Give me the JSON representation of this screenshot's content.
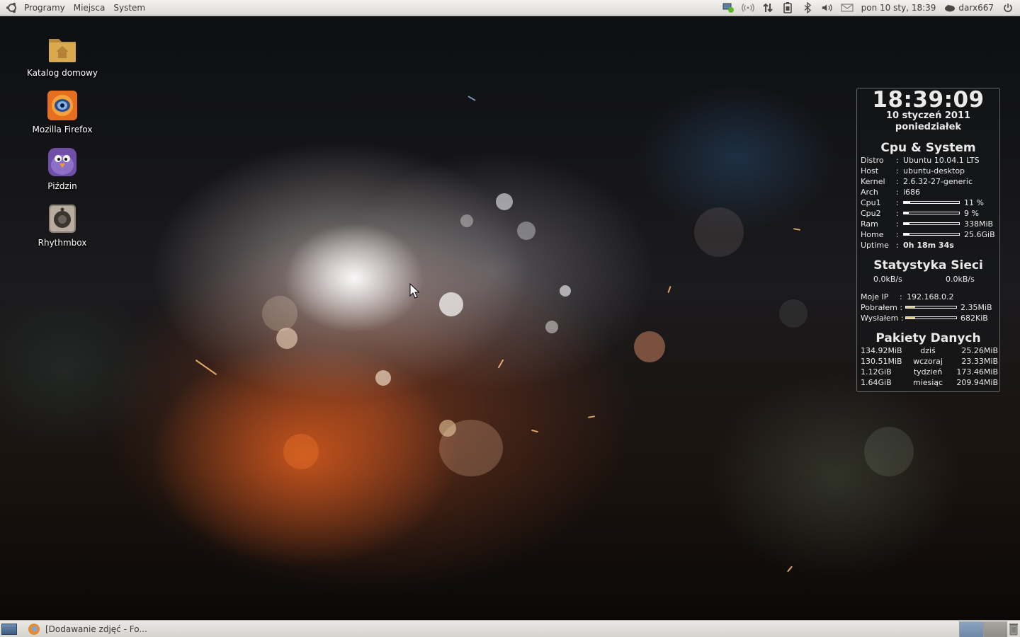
{
  "top_panel": {
    "menus": [
      "Programy",
      "Miejsca",
      "System"
    ],
    "clock": "pon 10 sty, 18:39",
    "user": "darx667",
    "icons": [
      "ubuntu-logo-icon",
      "network-status-icon",
      "wireless-icon",
      "network-transfer-icon",
      "battery-icon",
      "bluetooth-icon",
      "volume-icon",
      "mail-icon",
      "user-status-icon",
      "power-icon"
    ]
  },
  "desktop_icons": [
    {
      "label": "Katalog domowy",
      "icon": "home-folder-icon"
    },
    {
      "label": "Mozilla Firefox",
      "icon": "firefox-icon"
    },
    {
      "label": "Piździn",
      "icon": "pidgin-icon"
    },
    {
      "label": "Rhythmbox",
      "icon": "rhythmbox-icon"
    }
  ],
  "conky": {
    "time": "18:39:09",
    "date": "10 styczeń 2011",
    "weekday": "poniedziałek",
    "system_heading": "Cpu & System",
    "system_rows": [
      {
        "key": "Distro",
        "value": "Ubuntu 10.04.1 LTS"
      },
      {
        "key": "Host",
        "value": "ubuntu-desktop"
      },
      {
        "key": "Kernel",
        "value": "2.6.32-27-generic"
      },
      {
        "key": "Arch",
        "value": "i686"
      }
    ],
    "bars": [
      {
        "key": "Cpu1",
        "value": "11 %",
        "level": 0.11
      },
      {
        "key": "Cpu2",
        "value": "9 %",
        "level": 0.09
      },
      {
        "key": "Ram",
        "value": "338MiB",
        "level": 0.1
      },
      {
        "key": "Home",
        "value": "25.6GiB",
        "level": 0.1
      }
    ],
    "uptime_key": "Uptime",
    "uptime": "0h 18m 34s",
    "colon": ":",
    "net_heading": "Statystyka Sieci",
    "down_speed": "0.0kB/s",
    "up_speed": "0.0kB/s",
    "ip_key": "Moje IP",
    "ip": "192.168.0.2",
    "downloaded_key": "Pobrałem :",
    "downloaded": "2.35MiB",
    "downloaded_level": 0.18,
    "uploaded_key": "Wysłałem :",
    "uploaded": "682KiB",
    "uploaded_level": 0.18,
    "packets_heading": "Pakiety Danych",
    "packets": [
      {
        "down": "134.92MiB",
        "period": "dziś",
        "up": "25.26MiB"
      },
      {
        "down": "130.51MiB",
        "period": "wczoraj",
        "up": "23.33MiB"
      },
      {
        "down": "1.12GiB",
        "period": "tydzień",
        "up": "173.46MiB"
      },
      {
        "down": "1.64GiB",
        "period": "miesiąc",
        "up": "209.94MiB"
      }
    ]
  },
  "bottom_panel": {
    "task_label": "[Dodawanie zdjęć - Fo..."
  }
}
